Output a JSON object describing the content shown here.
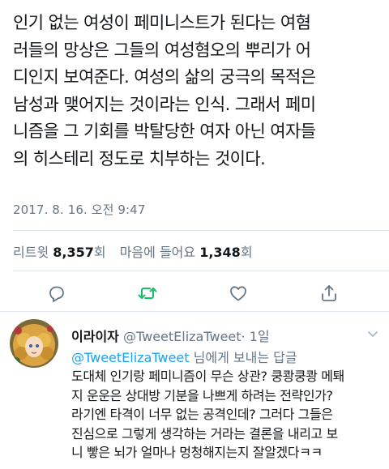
{
  "tweet": {
    "text": "인기 없는 여성이 페미니스트가 된다는 여혐\n러들의 망상은 그들의 여성혐오의 뿌리가 어\n디인지 보여준다. 여성의 삶의 궁극의 목적은\n남성과 맺어지는 것이라는 인식. 그래서 페미\n니즘을 그 기회를 박탈당한 여자 아닌 여자들\n의 히스테리 정도로 치부하는 것이다.",
    "date": "2017. 8. 16. 오전 9:47"
  },
  "stats": {
    "retweet_label": "리트윗",
    "retweet_count": "8,357",
    "retweet_unit": "회",
    "like_label": "마음에 들어요",
    "like_count": "1,348",
    "like_unit": "회"
  },
  "actions": {
    "icons": [
      "reply-icon",
      "retweet-icon",
      "like-icon",
      "share-icon"
    ],
    "retweet_color": "#17bf63",
    "icon_color": "#657786"
  },
  "reply": {
    "name": "이라이자",
    "handle": "@TweetElizaTweet",
    "time": "· 1일",
    "reply_to_handle": "@TweetElizaTweet",
    "reply_to_suffix": " 님에게 보내는 답글",
    "text": "도대체 인기랑 페미니즘이 무슨 상관? 쿵쾅쿵쾅 메퇘\n지 운운은 상대방 기분을 나쁘게 하려는 전략인가?\n라기엔 타격이 너무 없는 공격인데? 그러다 그들은\n진심으로 그렇게 생각하는 거라는 결론을 내리고 보\n니 빻은 뇌가 얼마나 멍청해지는지 잘알겠다ㅋㅋ"
  },
  "colors": {
    "text": "#14171a",
    "secondary": "#657786",
    "link": "#1da1f2",
    "divider": "#e1e8ed"
  }
}
